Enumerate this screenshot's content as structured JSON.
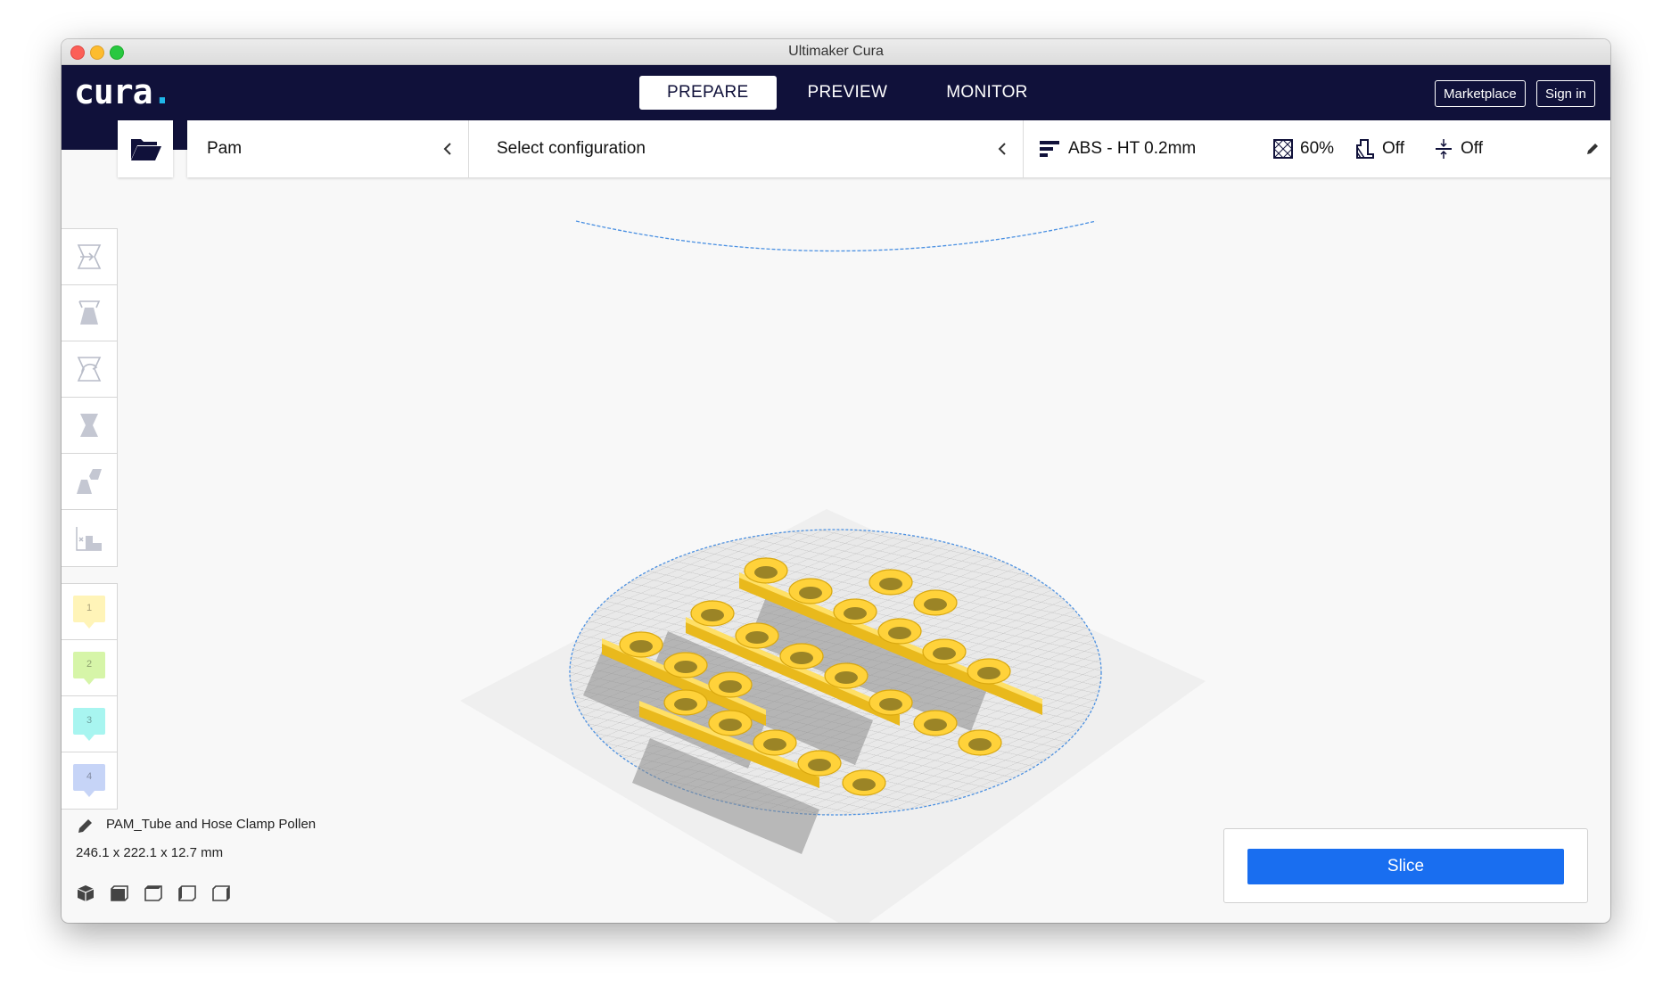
{
  "window": {
    "title": "Ultimaker Cura"
  },
  "header": {
    "logo": "cura",
    "stages": [
      "PREPARE",
      "PREVIEW",
      "MONITOR"
    ],
    "active_stage": "PREPARE",
    "marketplace_label": "Marketplace",
    "signin_label": "Sign in"
  },
  "toolbar": {
    "printer": "Pam",
    "configuration": "Select configuration",
    "profile": "ABS - HT 0.2mm",
    "infill": "60%",
    "support": "Off",
    "adhesion": "Off"
  },
  "side_tools": [
    {
      "name": "move-tool",
      "icon": "move-icon"
    },
    {
      "name": "scale-tool",
      "icon": "scale-icon"
    },
    {
      "name": "rotate-tool",
      "icon": "rotate-icon"
    },
    {
      "name": "mirror-tool",
      "icon": "mirror-icon"
    },
    {
      "name": "per-model-settings-tool",
      "icon": "per-model-settings-icon"
    },
    {
      "name": "support-blocker-tool",
      "icon": "support-blocker-icon"
    }
  ],
  "extruders": [
    {
      "label": "1",
      "color": "#fff4b8"
    },
    {
      "label": "2",
      "color": "#d6f5a8"
    },
    {
      "label": "3",
      "color": "#a8f5f0"
    },
    {
      "label": "4",
      "color": "#c6d4f7"
    }
  ],
  "object": {
    "name": "PAM_Tube and Hose Clamp Pollen",
    "dimensions": "246.1 x 222.1 x 12.7 mm"
  },
  "colors": {
    "header_bg": "#10113a",
    "accent_blue": "#196ef0",
    "model_yellow": "#ffd23a"
  },
  "slice": {
    "label": "Slice"
  }
}
